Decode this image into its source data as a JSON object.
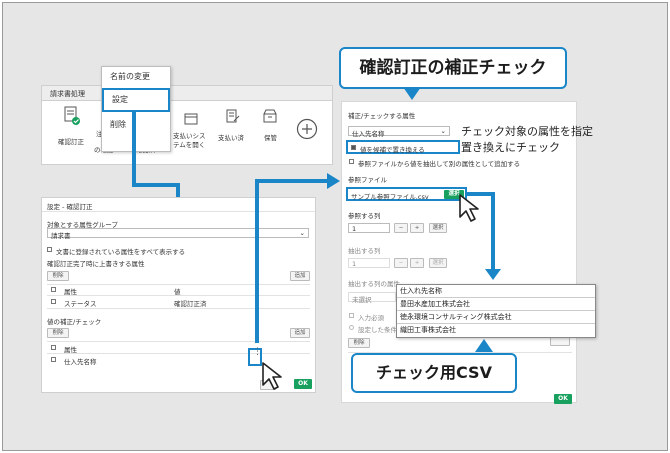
{
  "workflow": {
    "header": "請求書処理",
    "items": [
      "確認訂正",
      "注",
      "の確認",
      "確認済",
      "支払いシステムを開く",
      "支払い済",
      "保管"
    ],
    "buttons": [
      "支払いシス",
      "テムを開く",
      "支払い済",
      "保管"
    ]
  },
  "context_menu": {
    "rename": "名前の変更",
    "settings": "設定",
    "delete": "削除"
  },
  "settings_dialog": {
    "title": "設定 - 確認訂正",
    "group_label": "対象とする属性グループ",
    "group_value": "請求書",
    "show_all": "文書に登録されている属性をすべて表示する",
    "overwrite_label": "確認訂正完了時に上書きする属性",
    "delete": "削除",
    "add": "追加",
    "col_attr": "属性",
    "col_value": "値",
    "status_attr": "ステータス",
    "status_value": "確認訂正済",
    "check_label": "値の補正/チェック",
    "row_attr": "仕入先名称",
    "ok": "OK"
  },
  "right_panel": {
    "target_attr_label": "補正/チェックする属性",
    "target_attr_value": "仕入先名称",
    "replace_checkbox": "値を候補で置き換える",
    "extract_checkbox": "参照ファイルから値を抽出して別の属性として追加する",
    "ref_file_label": "参照ファイル",
    "ref_file_value": "サンプル参照ファイル.csv",
    "select": "選択",
    "ref_col_label": "参照する列",
    "ref_col_value": "1",
    "extract_col_label": "抽出する列",
    "extract_col_value": "1",
    "attr_label": "抽出する列の属性",
    "attr_value": "未選択",
    "required": "入力必須",
    "set_condition": "設定した条件",
    "delete": "削除",
    "plus": "+",
    "minus": "−",
    "ok": "OK"
  },
  "csv_rows": [
    "仕入れ先名称",
    "豊田水産加工株式会社",
    "徳永環境コンサルティング株式会社",
    "織田工事株式会社"
  ],
  "callouts": {
    "top": "確認訂正の補正チェック",
    "bottom": "チェック用CSV",
    "note_line1": "チェック対象の属性を指定",
    "note_line2": "置き換えにチェック"
  },
  "colors": {
    "accent": "#1a86c8",
    "ok": "#17a05e"
  }
}
